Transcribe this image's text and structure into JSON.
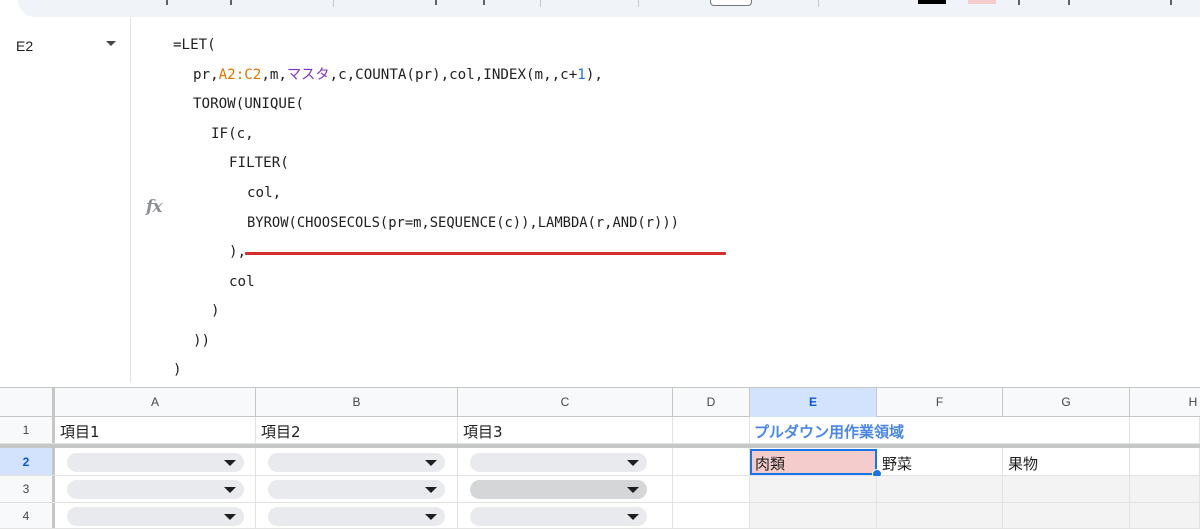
{
  "name_box": {
    "value": "E2"
  },
  "fx_label": "fx",
  "formula": {
    "l1": "=LET(",
    "l2_a": "pr,",
    "l2_range": "A2:C2",
    "l2_b": ",m,",
    "l2_name": "マスタ",
    "l2_c": ",c,COUNTA(pr),col,INDEX(m,,c+",
    "l2_num": "1",
    "l2_d": "),",
    "l3": "TOROW(UNIQUE(",
    "l4": "IF(c,",
    "l5": "FILTER(",
    "l6": "col,",
    "l7": "BYROW(CHOOSECOLS(pr=m,SEQUENCE(c)),LAMBDA(r,AND(r)))",
    "l8": "),",
    "l9": "col",
    "l10": ")",
    "l11": "))",
    "l12": ")"
  },
  "columns": [
    "A",
    "B",
    "C",
    "D",
    "E",
    "F",
    "G",
    "H"
  ],
  "rows": [
    "1",
    "2",
    "3",
    "4"
  ],
  "cells": {
    "A1": "項目1",
    "B1": "項目2",
    "C1": "項目3",
    "E1": "プルダウン用作業領域",
    "E2": "肉類",
    "F2": "野菜",
    "G2": "果物"
  },
  "colors": {
    "range": "#e37400",
    "named_range": "#8430ce",
    "number": "#1a73e8",
    "underline": "#d32f2f",
    "selection": "#1a73e8",
    "header_text": "#4a86e8",
    "selected_fill": "#f4cccc"
  },
  "icons": [
    "dropdown-arrow-icon",
    "fx-icon",
    "namebox-chevron-icon"
  ]
}
